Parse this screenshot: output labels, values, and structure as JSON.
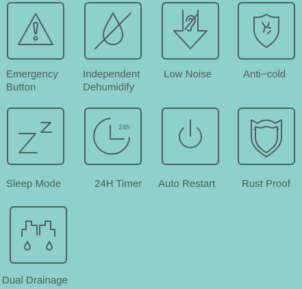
{
  "features": [
    {
      "id": "emergency",
      "line1": "Emergency",
      "line2": "Button",
      "icon": "warning-triangle-icon"
    },
    {
      "id": "dehumidify",
      "line1": "Independent",
      "line2": "Dehumidify",
      "icon": "no-water-drop-icon"
    },
    {
      "id": "low-noise",
      "line1": "Low Noise",
      "line2": "",
      "icon": "muted-ear-icon"
    },
    {
      "id": "anti-cold",
      "line1": "Anti−cold",
      "line2": "",
      "icon": "shield-snowflake-icon"
    },
    {
      "id": "sleep-mode",
      "line1": "Sleep Mode",
      "line2": "",
      "icon": "sleep-zz-icon"
    },
    {
      "id": "timer",
      "line1": "24H Timer",
      "line2": "",
      "icon": "clock-timer-icon",
      "icon_text": "24h"
    },
    {
      "id": "auto-restart",
      "line1": "Auto Restart",
      "line2": "",
      "icon": "power-icon"
    },
    {
      "id": "rust-proof",
      "line1": "Rust Proof",
      "line2": "",
      "icon": "shield-icon"
    },
    {
      "id": "dual-drainage",
      "line1": "Dual Drainage",
      "line2": "",
      "icon": "dual-drain-pipe-icon"
    }
  ],
  "colors": {
    "background": "#8ed0cb",
    "line": "#506060",
    "text": "#4d5d5d"
  }
}
